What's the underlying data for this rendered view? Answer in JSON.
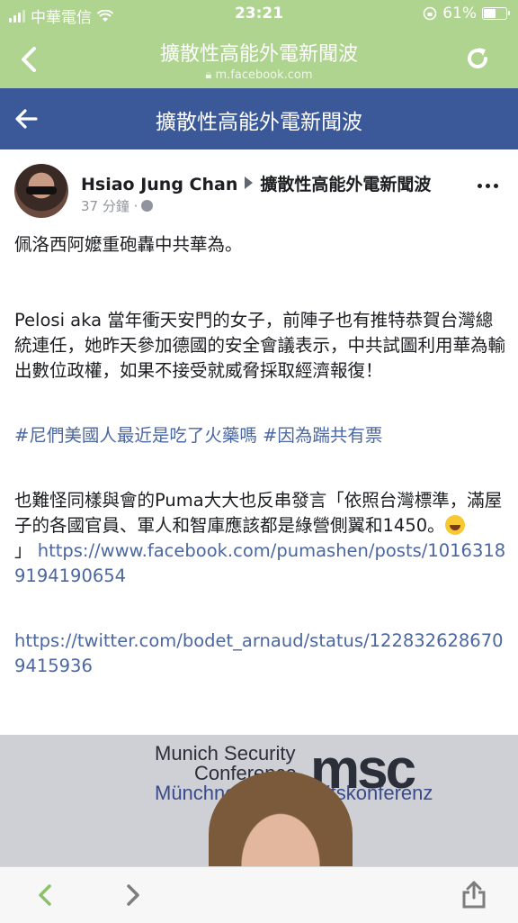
{
  "status_bar": {
    "carrier": "中華電信",
    "time": "23:21",
    "battery_percent": "61%",
    "battery_level": 0.61
  },
  "safari": {
    "title": "擴散性高能外電新聞波",
    "url": "m.facebook.com"
  },
  "fb_header": {
    "title": "擴散性高能外電新聞波"
  },
  "post": {
    "author": "Hsiao Jung Chan",
    "group": "擴散性高能外電新聞波",
    "time": "37 分鐘 ·",
    "line1": "佩洛西阿嬤重砲轟中共華為。",
    "para2": "Pelosi aka 當年衝天安門的女子，前陣子也有推特恭賀台灣總統連任，她昨天參加德國的安全會議表示，中共試圖利用華為輸出數位政權，如果不接受就威脅採取經濟報復！",
    "hashtag1": "#尼們美國人最近是吃了火藥嗎",
    "hashtag2": "#因為踹共有票",
    "para4": "也難怪同樣與會的Puma大大也反串發言「依照台灣標準，滿屋子的各國官員、軍人和智庫應該都是綠營側翼和1450。",
    "para4_end": "」",
    "link1": "https://www.facebook.com/pumashen/posts/10163189194190654",
    "link2": "https://twitter.com/bodet_arnaud/status/1228326286709415936"
  },
  "photo": {
    "line1": "Munich Security",
    "line2": "Conference",
    "line3": "Münchner Sicherheitskonferenz",
    "logo": "msc"
  }
}
